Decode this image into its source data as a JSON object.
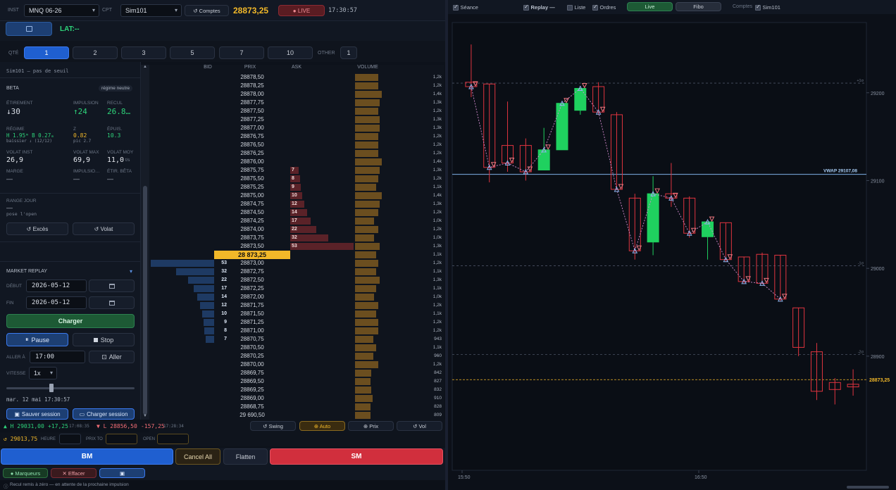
{
  "topbar": {
    "inst_label": "INST",
    "instrument": "MNQ 06-26",
    "cpt_label": "CPT",
    "account": "Sim101",
    "comptes_label": "↺ Comptes",
    "last_price": "28873,25",
    "live_label": "● LIVE",
    "time": "17:30:57"
  },
  "header2": {
    "lat": "LAT:--"
  },
  "qty": {
    "label": "QTÉ",
    "options": [
      "1",
      "2",
      "3",
      "5",
      "7",
      "10"
    ],
    "selected": "1",
    "other_label": "OTHER",
    "other_value": "1"
  },
  "panel": {
    "account_note": "Sim101 — pas de seuil",
    "beta_label": "BETA",
    "regime_badge": "régime neutre",
    "etirement_k": "ÉTIREMENT",
    "etirement_v": "↓30",
    "impulsion_k": "IMPULSION",
    "impulsion_v": "↑24",
    "recul_k": "RECUL",
    "recul_v": "26.8…",
    "regime_k": "RÉGIME",
    "regime_v": "H 1.95ᵐ  B 0.27ₘ",
    "regime_sub": "baissier ↓  (12/12)",
    "z_k": "Z",
    "z_v": "0.82",
    "z_sub": "pic 2.7",
    "epuis_k": "ÉPUIS.",
    "epuis_v": "10.3",
    "volat_inst_k": "VOLAT INST",
    "volat_inst_v": "26,9",
    "volat_max_k": "VOLAT MAX",
    "volat_max_v": "69,9",
    "volat_moy_k": "VOLAT MOY",
    "volat_moy_v": "11,0",
    "volat_moy_unit": "t/s",
    "marge_k": "MARGE",
    "marge_v": "—",
    "impulsio_k": "IMPULSIO…",
    "impulsio_v": "—",
    "etir_beta_k": "ÉTIR. BÊTA",
    "etir_beta_v": "—",
    "range_k": "RANGE JOUR",
    "range_v": "—",
    "range_sub": "pose l'open",
    "exces_btn": "↺ Excès",
    "volat_btn": "↺ Volat"
  },
  "replay": {
    "title": "MARKET REPLAY",
    "debut_label": "DÉBUT",
    "debut": "2026-05-12",
    "fin_label": "FIN",
    "fin": "2026-05-12",
    "charger": "Charger",
    "pause": "Pause",
    "stop": "Stop",
    "aller_a_label": "ALLER À",
    "aller_time": "17:00",
    "aller_btn": "Aller",
    "vitesse_label": "VITESSE",
    "vitesse": "1x",
    "speed_fraction": 0.35,
    "date_line": "mar. 12 mai   17:30:57",
    "save_session": "Sauver session",
    "load_session": "Charger session"
  },
  "ladder": {
    "headers": {
      "bid": "BID",
      "prix": "PRIX",
      "ask": "ASK",
      "volume": "VOLUME"
    },
    "current_price": "28 873,25",
    "rows": [
      {
        "p": "28878,50",
        "v": "1,2k",
        "vv": 1200
      },
      {
        "p": "28878,25",
        "v": "1,2k",
        "vv": 1200
      },
      {
        "p": "28878,00",
        "v": "1,4k",
        "vv": 1400
      },
      {
        "p": "28877,75",
        "v": "1,3k",
        "vv": 1300
      },
      {
        "p": "28877,50",
        "v": "1,2k",
        "vv": 1200
      },
      {
        "p": "28877,25",
        "v": "1,3k",
        "vv": 1300
      },
      {
        "p": "28877,00",
        "v": "1,3k",
        "vv": 1300
      },
      {
        "p": "28876,75",
        "v": "1,2k",
        "vv": 1200
      },
      {
        "p": "28876,50",
        "v": "1,2k",
        "vv": 1200
      },
      {
        "p": "28876,25",
        "v": "1,2k",
        "vv": 1200
      },
      {
        "p": "28876,00",
        "v": "1,4k",
        "vv": 1400
      },
      {
        "p": "28875,75",
        "v": "1,3k",
        "vv": 1300,
        "ask": "7",
        "an": 7
      },
      {
        "p": "28875,50",
        "v": "1,2k",
        "vv": 1200,
        "ask": "8",
        "an": 8
      },
      {
        "p": "28875,25",
        "v": "1,1k",
        "vv": 1100,
        "ask": "9",
        "an": 9
      },
      {
        "p": "28875,00",
        "v": "1,4k",
        "vv": 1400,
        "ask": "10",
        "an": 10
      },
      {
        "p": "28874,75",
        "v": "1,3k",
        "vv": 1300,
        "ask": "12",
        "an": 12
      },
      {
        "p": "28874,50",
        "v": "1,2k",
        "vv": 1200,
        "ask": "14",
        "an": 14
      },
      {
        "p": "28874,25",
        "v": "1,0k",
        "vv": 1000,
        "ask": "17",
        "an": 17
      },
      {
        "p": "28874,00",
        "v": "1,2k",
        "vv": 1200,
        "ask": "22",
        "an": 22
      },
      {
        "p": "28873,75",
        "v": "1,0k",
        "vv": 1000,
        "ask": "32",
        "an": 32
      },
      {
        "p": "28873,50",
        "v": "1,3k",
        "vv": 1300,
        "ask": "53",
        "an": 53
      },
      {
        "p": "28 873,25",
        "v": "1,1k",
        "vv": 1100,
        "cur": true
      },
      {
        "p": "28873,00",
        "v": "1,2k",
        "vv": 1200,
        "bid": "53",
        "bn": 53
      },
      {
        "p": "28872,75",
        "v": "1,1k",
        "vv": 1100,
        "bid": "32",
        "bn": 32
      },
      {
        "p": "28872,50",
        "v": "1,3k",
        "vv": 1300,
        "bid": "22",
        "bn": 22
      },
      {
        "p": "28872,25",
        "v": "1,1k",
        "vv": 1100,
        "bid": "17",
        "bn": 17
      },
      {
        "p": "28872,00",
        "v": "1,0k",
        "vv": 1000,
        "bid": "14",
        "bn": 14
      },
      {
        "p": "28871,75",
        "v": "1,2k",
        "vv": 1200,
        "bid": "12",
        "bn": 12
      },
      {
        "p": "28871,50",
        "v": "1,1k",
        "vv": 1100,
        "bid": "10",
        "bn": 10
      },
      {
        "p": "28871,25",
        "v": "1,2k",
        "vv": 1200,
        "bid": "9",
        "bn": 9
      },
      {
        "p": "28871,00",
        "v": "1,2k",
        "vv": 1200,
        "bid": "8",
        "bn": 8
      },
      {
        "p": "28870,75",
        "v": "943",
        "vv": 943,
        "bid": "7",
        "bn": 7
      },
      {
        "p": "28870,50",
        "v": "1,1k",
        "vv": 1100
      },
      {
        "p": "28870,25",
        "v": "960",
        "vv": 960
      },
      {
        "p": "28870,00",
        "v": "1,2k",
        "vv": 1200
      },
      {
        "p": "28869,75",
        "v": "842",
        "vv": 842
      },
      {
        "p": "28869,50",
        "v": "827",
        "vv": 827
      },
      {
        "p": "28869,25",
        "v": "832",
        "vv": 832
      },
      {
        "p": "28869,00",
        "v": "910",
        "vv": 910
      },
      {
        "p": "28868,75",
        "v": "828",
        "vv": 828
      },
      {
        "p": "29 690,50",
        "v": "809",
        "vv": 809
      }
    ]
  },
  "modes": {
    "swing": "↺ Swing",
    "auto": "⊕ Auto",
    "prix": "⊕ Prix",
    "vol": "↺ Vol"
  },
  "stats": {
    "high": "▲ H 29031,00",
    "high_delta": "+17,25",
    "high_time": "17:08:35",
    "low": "▼ L 28856,50",
    "low_delta": "-157,25",
    "low_time": "17:28:34",
    "ref": "↺ 29013,75",
    "heure_label": "HEURE",
    "prix_to_label": "PRIX TO",
    "open_label": "OPEN"
  },
  "trade": {
    "bm": "BM",
    "cancel_all": "Cancel All",
    "flatten": "Flatten",
    "sm": "SM",
    "marqueurs": "● Marqueurs",
    "effacer": "✕ Effacer",
    "status": "Recul remis à zéro — en attente de la prochaine impulsion"
  },
  "chart_top": {
    "seance": "Séance",
    "replay": "Replay —",
    "liste": "Liste",
    "ordres": "Ordres",
    "live": "Live",
    "fibo": "Fibo",
    "comptes": "Comptes",
    "sim": "Sim101"
  },
  "chart_data": {
    "type": "candlestick",
    "yticks": [
      29200,
      29100,
      29000,
      28900
    ],
    "ylim": [
      28770,
      29280
    ],
    "xticks": [
      "15:50",
      "16:50"
    ],
    "vwap": {
      "label": "VWAP 29107,08",
      "value": 29107.08
    },
    "last": {
      "label": "28873,25",
      "value": 28873.25
    },
    "levels": [
      {
        "label": "+1σ",
        "value": 29211
      },
      {
        "label": "-1σ",
        "value": 29003
      },
      {
        "label": "-2σ",
        "value": 28902
      }
    ],
    "candles": [
      {
        "o": 29212,
        "h": 29255,
        "l": 29195,
        "c": 29207
      },
      {
        "o": 29210,
        "h": 29210,
        "l": 29098,
        "c": 29115
      },
      {
        "o": 29140,
        "h": 29190,
        "l": 29110,
        "c": 29120
      },
      {
        "o": 29140,
        "h": 29148,
        "l": 29100,
        "c": 29110
      },
      {
        "o": 29112,
        "h": 29160,
        "l": 29112,
        "c": 29135
      },
      {
        "o": 29135,
        "h": 29185,
        "l": 29135,
        "c": 29188
      },
      {
        "o": 29180,
        "h": 29205,
        "l": 29175,
        "c": 29205
      },
      {
        "o": 29207,
        "h": 29212,
        "l": 29175,
        "c": 29178
      },
      {
        "o": 29175,
        "h": 29178,
        "l": 29090,
        "c": 29090
      },
      {
        "o": 29080,
        "h": 29085,
        "l": 29010,
        "c": 29020
      },
      {
        "o": 29030,
        "h": 29105,
        "l": 29015,
        "c": 29085
      },
      {
        "o": 29085,
        "h": 29120,
        "l": 29070,
        "c": 29080
      },
      {
        "o": 29080,
        "h": 29082,
        "l": 29035,
        "c": 29040
      },
      {
        "o": 29036,
        "h": 29053,
        "l": 29010,
        "c": 29053
      },
      {
        "o": 29052,
        "h": 29052,
        "l": 29008,
        "c": 29010
      },
      {
        "o": 29013,
        "h": 29013,
        "l": 28983,
        "c": 28985
      },
      {
        "o": 29016,
        "h": 29018,
        "l": 28983,
        "c": 28983
      },
      {
        "o": 29015,
        "h": 29015,
        "l": 28963,
        "c": 28965
      },
      {
        "o": 28955,
        "h": 28955,
        "l": 28900,
        "c": 28910
      },
      {
        "o": 28905,
        "h": 28915,
        "l": 28850,
        "c": 28860
      },
      {
        "o": 28870,
        "h": 28875,
        "l": 28845,
        "c": 28862
      },
      {
        "o": 28868,
        "h": 28885,
        "l": 28855,
        "c": 28865
      }
    ]
  }
}
